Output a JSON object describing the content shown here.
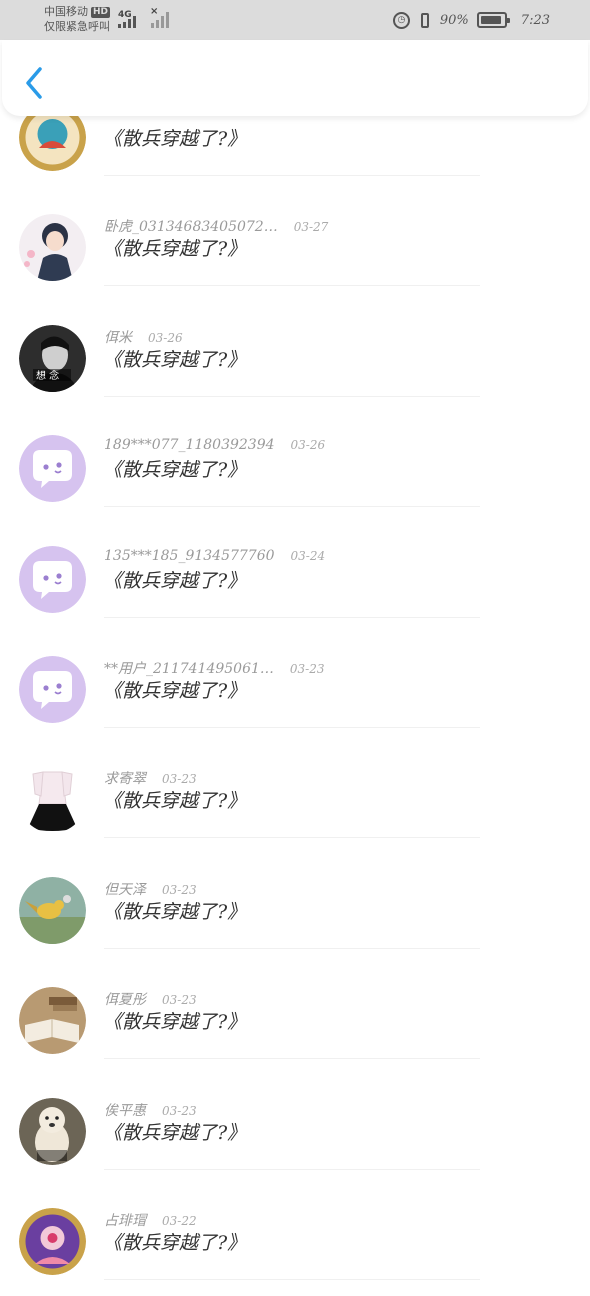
{
  "status_bar": {
    "carrier_line1": "中国移动",
    "hd_badge": "HD",
    "carrier_line2": "仅限紧急呼叫",
    "network": "4G",
    "battery_percent": "90%",
    "time": "7:23",
    "battery_level": 0.9
  },
  "colors": {
    "accent_blue": "#2a9be8",
    "default_avatar_purple": "#d6c3ef"
  },
  "comments": [
    {
      "user": "",
      "date": "",
      "title": "《散兵穿越了?》",
      "avatar": "emblem-avatar"
    },
    {
      "user": "卧虎_03134683405072…",
      "date": "03-27",
      "title": "《散兵穿越了?》",
      "avatar": "anime-boy-avatar"
    },
    {
      "user": "佴米",
      "date": "03-26",
      "title": "《散兵穿越了?》",
      "avatar": "portrait-avatar"
    },
    {
      "user": "189***077_1180392394",
      "date": "03-26",
      "title": "《散兵穿越了?》",
      "avatar": "default-chat-avatar"
    },
    {
      "user": "135***185_9134577760",
      "date": "03-24",
      "title": "《散兵穿越了?》",
      "avatar": "default-chat-avatar"
    },
    {
      "user": "**用户_211741495061…",
      "date": "03-23",
      "title": "《散兵穿越了?》",
      "avatar": "default-chat-avatar"
    },
    {
      "user": "求寄翠",
      "date": "03-23",
      "title": "《散兵穿越了?》",
      "avatar": "dress-avatar"
    },
    {
      "user": "但天泽",
      "date": "03-23",
      "title": "《散兵穿越了?》",
      "avatar": "bird-avatar"
    },
    {
      "user": "佴夏彤",
      "date": "03-23",
      "title": "《散兵穿越了?》",
      "avatar": "book-avatar"
    },
    {
      "user": "俟平惠",
      "date": "03-23",
      "title": "《散兵穿越了?》",
      "avatar": "dog-avatar"
    },
    {
      "user": "占琲瑁",
      "date": "03-22",
      "title": "《散兵穿越了?》",
      "avatar": "game-character-avatar"
    }
  ]
}
